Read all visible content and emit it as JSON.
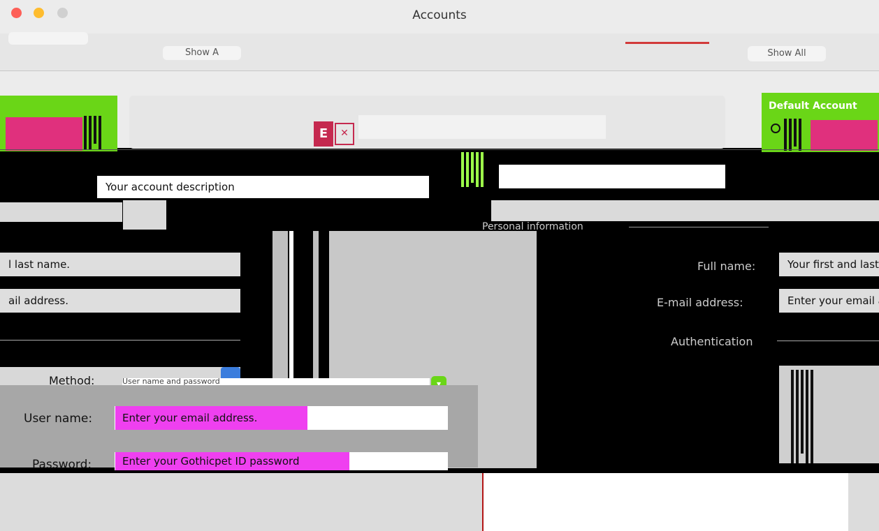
{
  "window": {
    "title": "Accounts"
  },
  "toolbar": {
    "show_all_label": "Show A",
    "show_all_right_label": "Show All"
  },
  "accounts": {
    "default_account_label": "Default Account"
  },
  "account": {
    "description_placeholder": "Your account description"
  },
  "personal": {
    "section_title": "Personal information",
    "full_name_label": "Full name:",
    "full_name_placeholder": "Your first and last name.",
    "full_name_left_fragment": "l last name.",
    "email_label": "E-mail address:",
    "email_placeholder": "Enter your email address.",
    "email_left_fragment": "ail address."
  },
  "auth": {
    "section_title": "Authentication",
    "method_label": "Method:",
    "method_value": "User name and password",
    "user_name_label": "User name:",
    "user_name_placeholder": "Enter your email address.",
    "password_label": "Password:",
    "password_placeholder": "Enter your Gothicpet ID password"
  },
  "colors": {
    "accent_green": "#6ad617",
    "accent_pink": "#e0307d",
    "magenta_field": "#ef40f0",
    "exchange_red": "#c5294f"
  }
}
